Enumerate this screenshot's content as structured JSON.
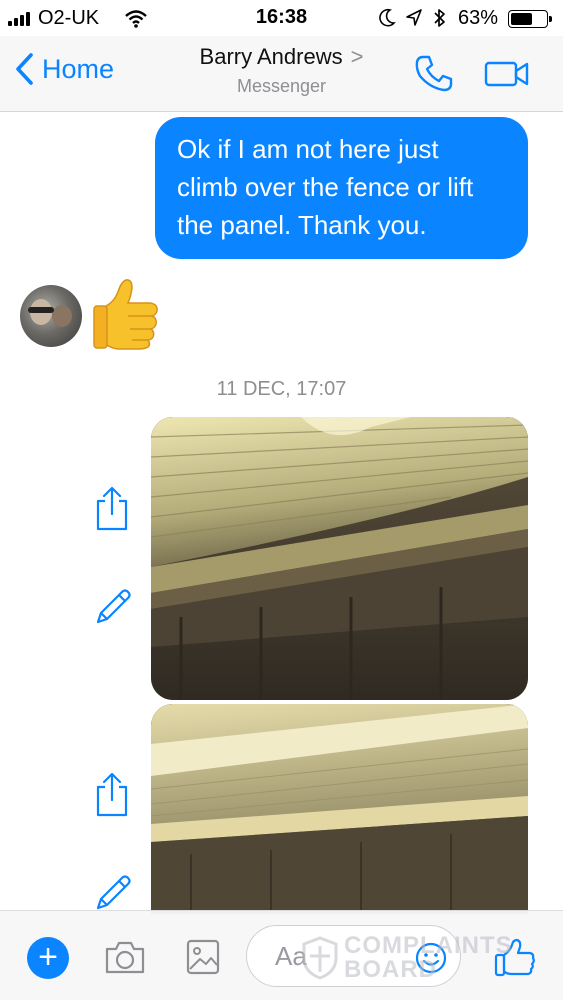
{
  "status_bar": {
    "carrier": "O2-UK",
    "time": "16:38",
    "battery_percent": "63%",
    "battery_level": 0.63,
    "icons": [
      "signal-bars-icon",
      "wifi-icon",
      "moon-icon",
      "location-arrow-icon",
      "bluetooth-icon",
      "battery-icon"
    ]
  },
  "nav": {
    "back_label": "Home",
    "contact_name": "Barry Andrews",
    "contact_chevron": ">",
    "subtitle": "Messenger",
    "icons": [
      "phone-icon",
      "video-camera-icon"
    ]
  },
  "conversation": {
    "outgoing_message": "Ok if I am not here just climb over the fence or lift the panel. Thank you.",
    "reply_emoji_icon": "thumbs-up-emoji",
    "timestamp": "11 DEC, 17:07",
    "photos": [
      "shed-roof-photo",
      "shed-roof-photo"
    ]
  },
  "composer": {
    "placeholder": "Aa",
    "icons": [
      "plus-icon",
      "camera-icon",
      "image-icon",
      "emoji-icon",
      "like-icon"
    ]
  },
  "watermark": {
    "line1": "COMPLAINTS",
    "line2": "BOARD"
  },
  "colors": {
    "accent": "#0a84ff",
    "bubble_text": "#ffffff",
    "secondary_text": "#8e8e93"
  }
}
